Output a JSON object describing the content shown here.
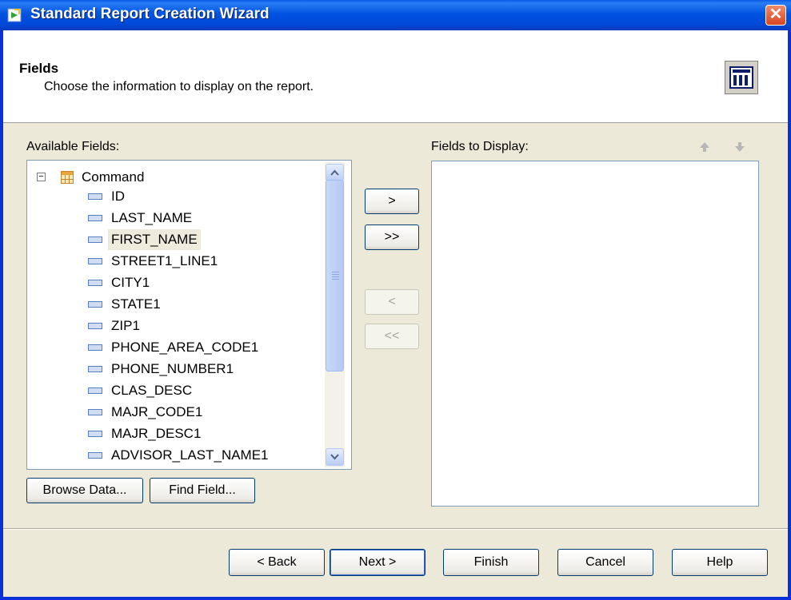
{
  "window": {
    "title": "Standard Report Creation Wizard",
    "close_glyph": "✕"
  },
  "header": {
    "title": "Fields",
    "description": "Choose the information to display on the report."
  },
  "available": {
    "label": "Available Fields:",
    "root": "Command",
    "expander": "−",
    "fields": [
      "ID",
      "LAST_NAME",
      "FIRST_NAME",
      "STREET1_LINE1",
      "CITY1",
      "STATE1",
      "ZIP1",
      "PHONE_AREA_CODE1",
      "PHONE_NUMBER1",
      "CLAS_DESC",
      "MAJR_CODE1",
      "MAJR_DESC1",
      "ADVISOR_LAST_NAME1"
    ],
    "selected_index": 2,
    "browse_label": "Browse Data...",
    "find_label": "Find Field..."
  },
  "display": {
    "label": "Fields to Display:"
  },
  "transfer": {
    "add_one": ">",
    "add_all": ">>",
    "remove_one": "<",
    "remove_all": "<<"
  },
  "footer": {
    "back": "< Back",
    "next": "Next >",
    "finish": "Finish",
    "cancel": "Cancel",
    "help": "Help"
  },
  "colors": {
    "title_bar": "#0054e3",
    "selection_bg": "#eeeadc",
    "dialog_bg": "#ece9d8"
  }
}
